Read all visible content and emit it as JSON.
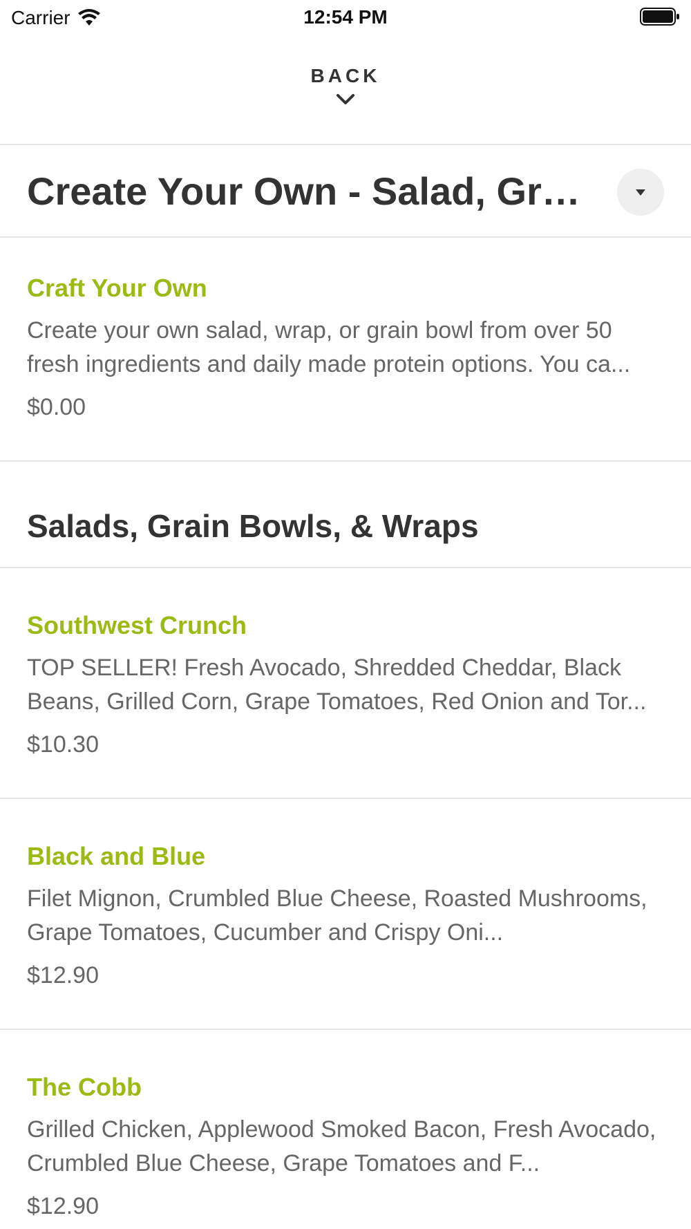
{
  "status_bar": {
    "carrier": "Carrier",
    "time": "12:54 PM"
  },
  "header": {
    "back_label": "BACK"
  },
  "category": {
    "title": "Create Your Own - Salad, Grain Bowls, & Wraps"
  },
  "featured": {
    "name": "Craft Your Own",
    "description": "Create your own salad, wrap, or grain bowl from over 50 fresh ingredients and daily made protein options. You ca...",
    "price": "$0.00"
  },
  "section": {
    "title": "Salads, Grain Bowls, & Wraps"
  },
  "items": [
    {
      "name": "Southwest Crunch",
      "description": "TOP SELLER! Fresh Avocado, Shredded Cheddar, Black Beans, Grilled Corn, Grape Tomatoes, Red Onion and Tor...",
      "price": "$10.30"
    },
    {
      "name": "Black and Blue",
      "description": "Filet Mignon, Crumbled Blue Cheese, Roasted Mushrooms, Grape Tomatoes, Cucumber and Crispy Oni...",
      "price": "$12.90"
    },
    {
      "name": "The Cobb",
      "description": "Grilled Chicken, Applewood Smoked Bacon, Fresh Avocado, Crumbled Blue Cheese, Grape Tomatoes and F...",
      "price": "$12.90"
    }
  ],
  "colors": {
    "item_name": "#99bb14",
    "body_text": "#666666",
    "heading_text": "#333333",
    "divider": "#e6e6e6"
  }
}
